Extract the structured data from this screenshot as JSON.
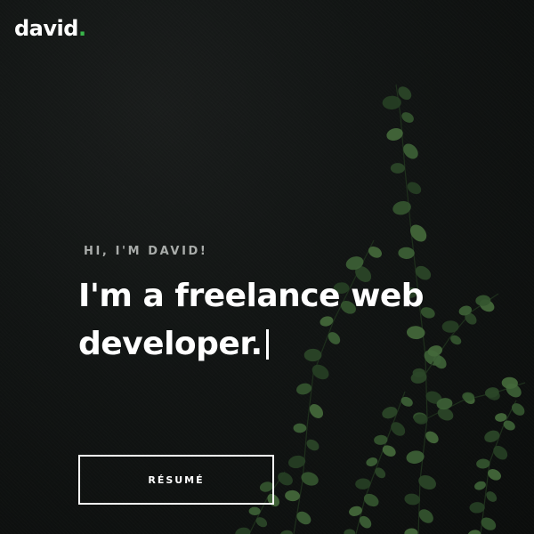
{
  "logo": {
    "text": "david",
    "dot": ".",
    "accent_color": "#39b54a"
  },
  "hero": {
    "eyebrow": "HI, I'M DAVID!",
    "headline": "I'm a freelance web developer.",
    "cta_label": "RÉSUMÉ"
  },
  "background": {
    "base_color": "#0d0f0e",
    "leaf_color": "#2f4a2c"
  }
}
